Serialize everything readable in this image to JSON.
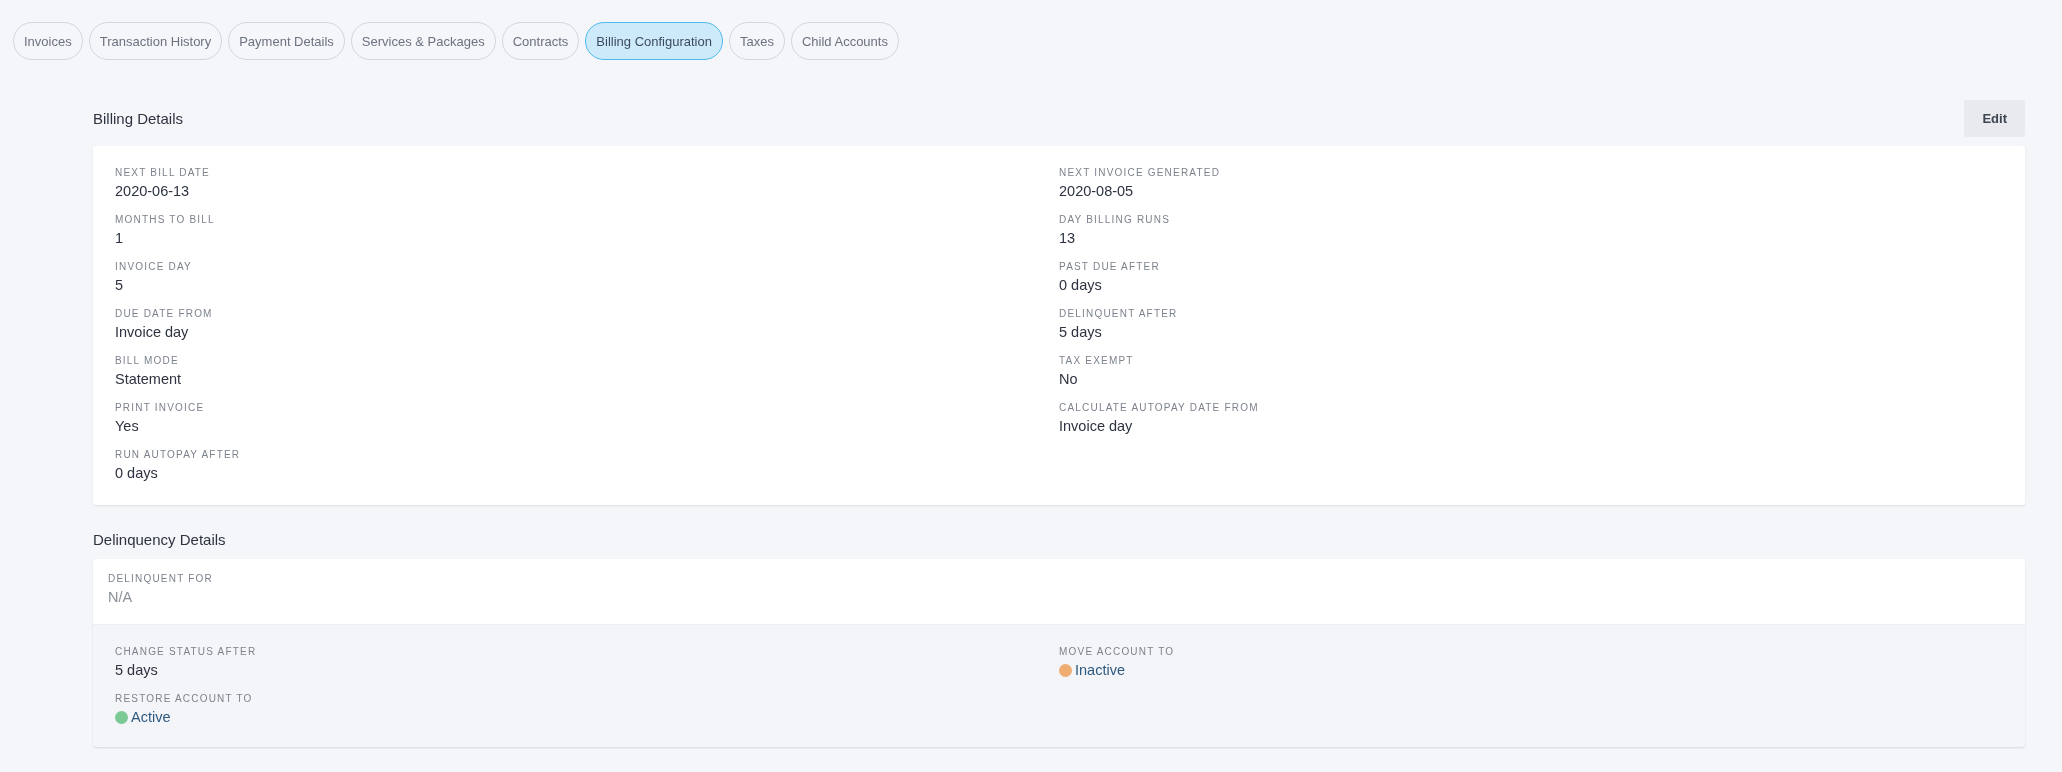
{
  "tabs": [
    {
      "label": "Invoices",
      "selected": false
    },
    {
      "label": "Transaction History",
      "selected": false
    },
    {
      "label": "Payment Details",
      "selected": false
    },
    {
      "label": "Services & Packages",
      "selected": false
    },
    {
      "label": "Contracts",
      "selected": false
    },
    {
      "label": "Billing Configuration",
      "selected": true
    },
    {
      "label": "Taxes",
      "selected": false
    },
    {
      "label": "Child Accounts",
      "selected": false
    }
  ],
  "billing_details": {
    "title": "Billing Details",
    "edit_button": "Edit",
    "left_column": [
      {
        "label": "NEXT BILL DATE",
        "value": "2020-06-13"
      },
      {
        "label": "MONTHS TO BILL",
        "value": "1"
      },
      {
        "label": "INVOICE DAY",
        "value": "5"
      },
      {
        "label": "DUE DATE FROM",
        "value": "Invoice day"
      },
      {
        "label": "BILL MODE",
        "value": "Statement"
      },
      {
        "label": "PRINT INVOICE",
        "value": "Yes"
      },
      {
        "label": "RUN AUTOPAY AFTER",
        "value": "0 days"
      }
    ],
    "right_column": [
      {
        "label": "NEXT INVOICE GENERATED",
        "value": "2020-08-05"
      },
      {
        "label": "DAY BILLING RUNS",
        "value": "13"
      },
      {
        "label": "PAST DUE AFTER",
        "value": "0 days"
      },
      {
        "label": "DELINQUENT AFTER",
        "value": "5 days"
      },
      {
        "label": "TAX EXEMPT",
        "value": "No"
      },
      {
        "label": "CALCULATE AUTOPAY DATE FROM",
        "value": "Invoice day"
      }
    ]
  },
  "delinquency_details": {
    "title": "Delinquency Details",
    "delinquent_for": {
      "label": "DELINQUENT FOR",
      "value": "N/A"
    },
    "left_column": [
      {
        "label": "CHANGE STATUS AFTER",
        "value": "5 days"
      },
      {
        "label": "RESTORE ACCOUNT TO",
        "value": "Active",
        "color": "#7bc995"
      }
    ],
    "right_column": [
      {
        "label": "MOVE ACCOUNT TO",
        "value": "Inactive",
        "color": "#efad72"
      }
    ]
  }
}
